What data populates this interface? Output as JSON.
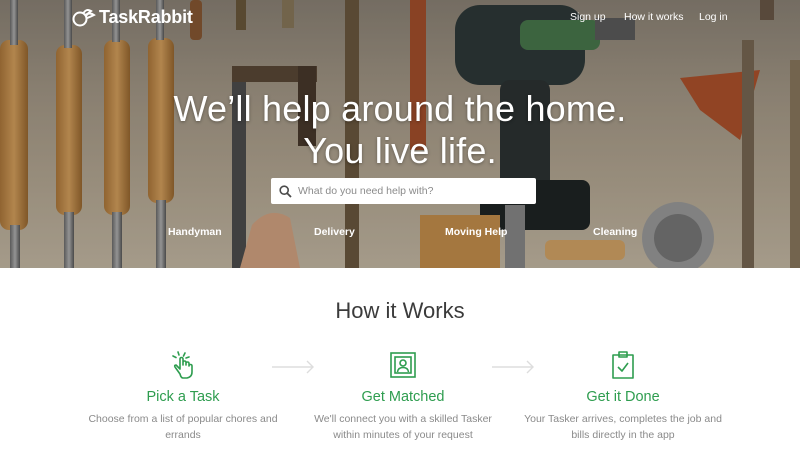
{
  "brand": {
    "name": "TaskRabbit"
  },
  "nav": {
    "sign_up": "Sign up",
    "how_it_works": "How it works",
    "log_in": "Log in"
  },
  "hero": {
    "headline_line1": "We’ll help around the home.",
    "headline_line2": "You live life."
  },
  "search": {
    "placeholder": "What do you need help with?",
    "value": "",
    "icon": "search-icon"
  },
  "categories": [
    "Handyman",
    "Delivery",
    "Moving Help",
    "Cleaning"
  ],
  "how_it_works": {
    "title": "How it Works",
    "steps": [
      {
        "icon": "pointing-hand-icon",
        "title": "Pick a Task",
        "description": "Choose from a list of popular chores and errands"
      },
      {
        "icon": "profile-card-icon",
        "title": "Get Matched",
        "description": "We'll connect you with a skilled Tasker within minutes of your request"
      },
      {
        "icon": "clipboard-check-icon",
        "title": "Get it Done",
        "description": "Your Tasker arrives, completes the job and bills directly in the app"
      }
    ]
  },
  "colors": {
    "accent_green": "#2e9d4f",
    "text_dark": "#3b3b3b",
    "text_muted": "#8a8a8a",
    "arrow": "#dddddd"
  }
}
